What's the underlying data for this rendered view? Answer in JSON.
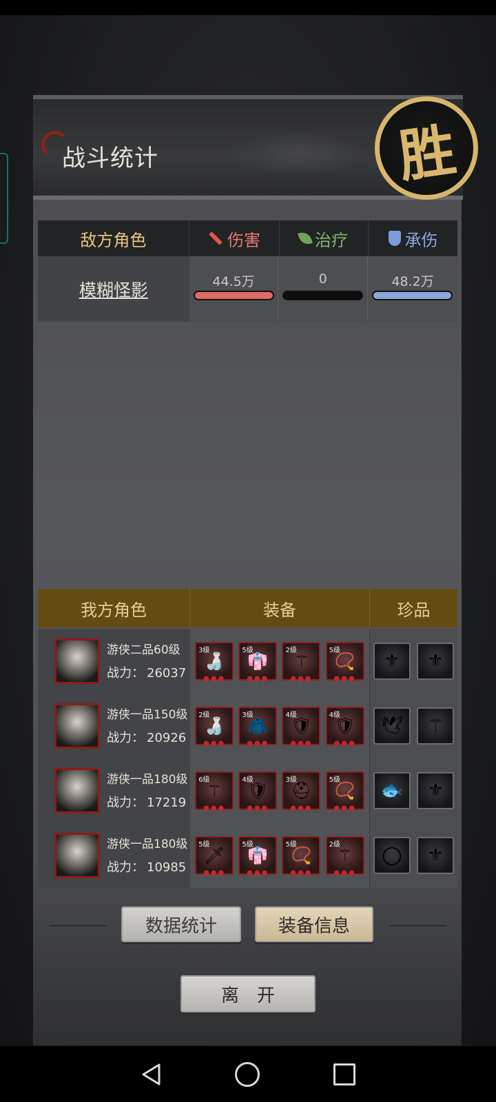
{
  "header": {
    "title": "战斗统计",
    "victory_mark": "胜"
  },
  "enemy_table": {
    "headers": {
      "role": "敌方角色",
      "damage": "伤害",
      "heal": "治疗",
      "tank": "承伤"
    },
    "rows": [
      {
        "name": "模糊怪影",
        "damage": "44.5万",
        "heal": "0",
        "tank": "48.2万"
      }
    ]
  },
  "ally_table": {
    "headers": {
      "role": "我方角色",
      "equipment": "装备",
      "treasure": "珍品"
    },
    "power_label": "战力：",
    "rows": [
      {
        "class": "游侠二品60级",
        "power": "26037",
        "equipment": [
          {
            "level": "3级",
            "icon": "gourd-icon"
          },
          {
            "level": "5级",
            "icon": "robe-icon"
          },
          {
            "level": "2级",
            "icon": "staff-icon"
          },
          {
            "level": "5级",
            "icon": "beads-icon"
          }
        ],
        "treasures": [
          "golden-staff-icon",
          "golden-staff-icon"
        ]
      },
      {
        "class": "游侠一品150级",
        "power": "20926",
        "equipment": [
          {
            "level": "2级",
            "icon": "gourd-icon"
          },
          {
            "level": "3级",
            "icon": "cloak-icon"
          },
          {
            "level": "4级",
            "icon": "armor-icon"
          },
          {
            "level": "4级",
            "icon": "armor-icon"
          }
        ],
        "treasures": [
          "bird-statue-icon",
          "staff-icon"
        ]
      },
      {
        "class": "游侠一品180级",
        "power": "17219",
        "equipment": [
          {
            "level": "6级",
            "icon": "staff-icon"
          },
          {
            "level": "4级",
            "icon": "armor-icon"
          },
          {
            "level": "3级",
            "icon": "helmet-icon"
          },
          {
            "level": "5级",
            "icon": "beads-icon"
          }
        ],
        "treasures": [
          "fish-statue-icon",
          "golden-staff-icon"
        ]
      },
      {
        "class": "游侠一品180级",
        "power": "10985",
        "equipment": [
          {
            "level": "5级",
            "icon": "sword-icon"
          },
          {
            "level": "5级",
            "icon": "robe-icon"
          },
          {
            "level": "5级",
            "icon": "beads-icon"
          },
          {
            "level": "2级",
            "icon": "staff-icon"
          }
        ],
        "treasures": [
          "jade-bracelet-icon",
          "golden-staff-icon"
        ]
      }
    ]
  },
  "buttons": {
    "data_stats": "数据统计",
    "equip_info": "装备信息",
    "leave": "离开"
  },
  "colors": {
    "gold": "#e8c67e",
    "damage": "#e06b62",
    "heal": "#85b36f",
    "tank": "#8aa7dc",
    "ally_header": "#634c12"
  }
}
